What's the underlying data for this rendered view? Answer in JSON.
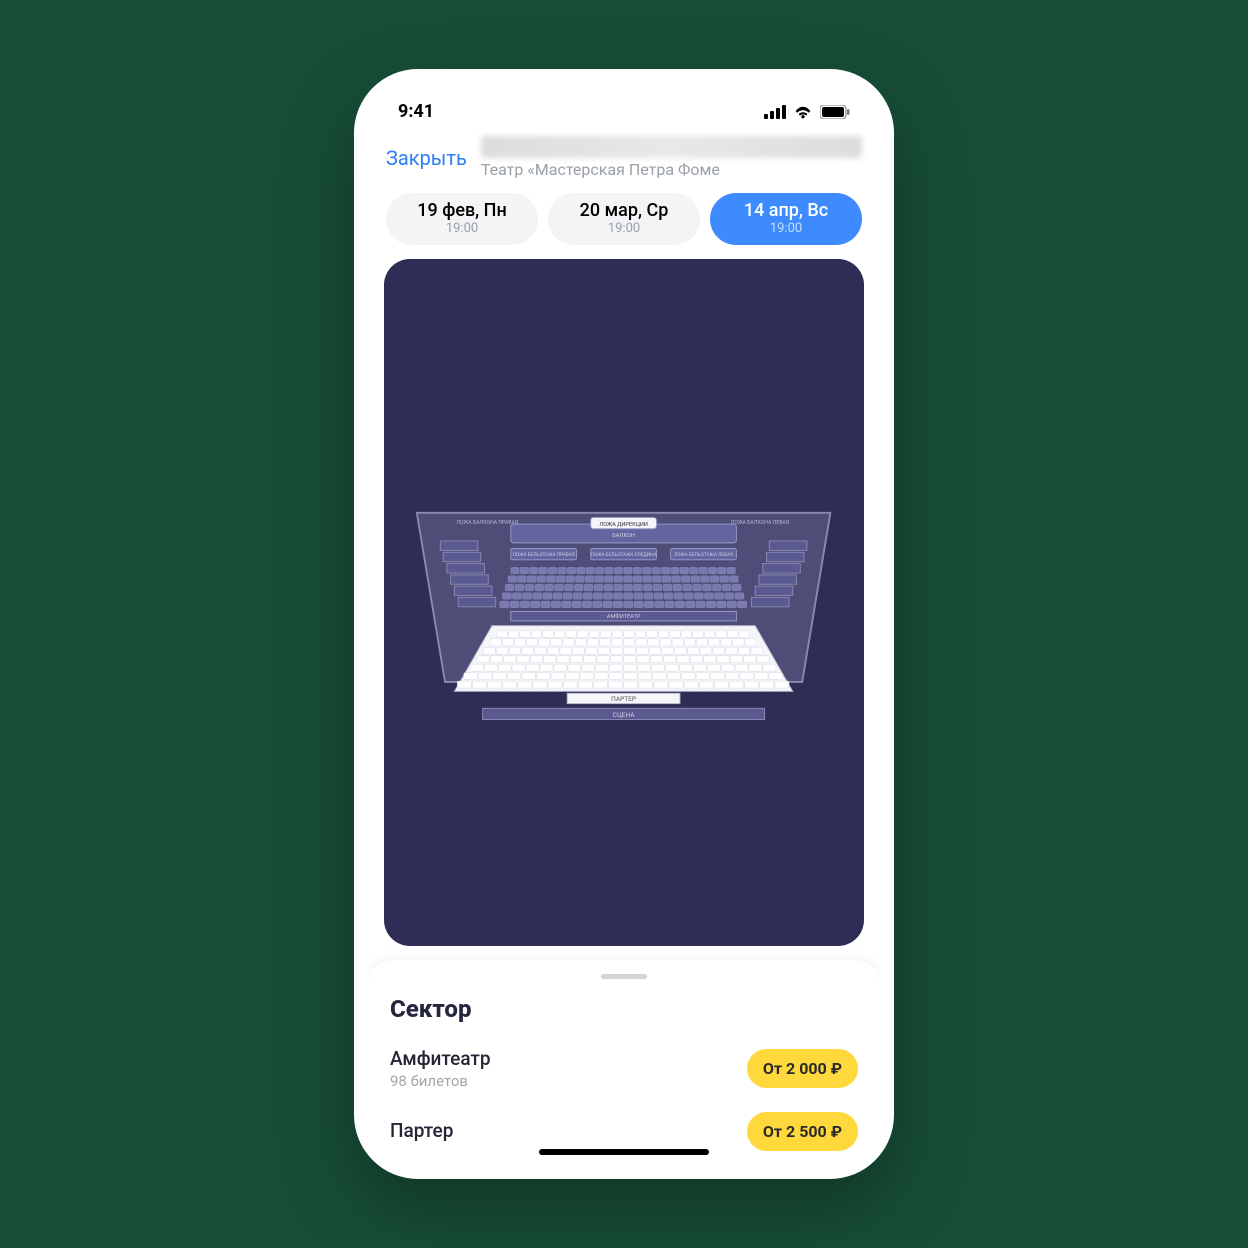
{
  "status": {
    "time": "9:41"
  },
  "header": {
    "close_label": "Закрыть",
    "venue": "Театр «Мастерская Петра Фоме"
  },
  "dates": [
    {
      "label": "19 фев, Пн",
      "time": "19:00",
      "active": false
    },
    {
      "label": "20 мар, Ср",
      "time": "19:00",
      "active": false
    },
    {
      "label": "14 апр, Вс",
      "time": "19:00",
      "active": true
    }
  ],
  "seatmap": {
    "sections": {
      "parterre": "ПАРТЕР",
      "stage": "СЦЕНА",
      "amphi": "АМФИТЕАТР",
      "balcony": "БАЛКОН",
      "director_box": "ЛОЖА ДИРЕКЦИИ",
      "balcony_box_right": "ЛОЖА БАЛКОНА ПРАВАЯ",
      "balcony_box_left": "ЛОЖА БАЛКОНА ЛЕВАЯ",
      "bel_right": "ЛОЖА БЕЛЬЭТАЖА ПРАВАЯ",
      "bel_mid": "ЛОЖА БЕЛЬЭТАЖА СРЕДИНА",
      "bel_left": "ЛОЖА БЕЛЬЭТАЖА ЛЕВАЯ"
    }
  },
  "sheet": {
    "title": "Сектор",
    "sectors": [
      {
        "name": "Амфитеатр",
        "count": "98 билетов",
        "price": "От 2 000 ₽"
      },
      {
        "name": "Партер",
        "count": "",
        "price": "От 2 500 ₽"
      }
    ]
  }
}
